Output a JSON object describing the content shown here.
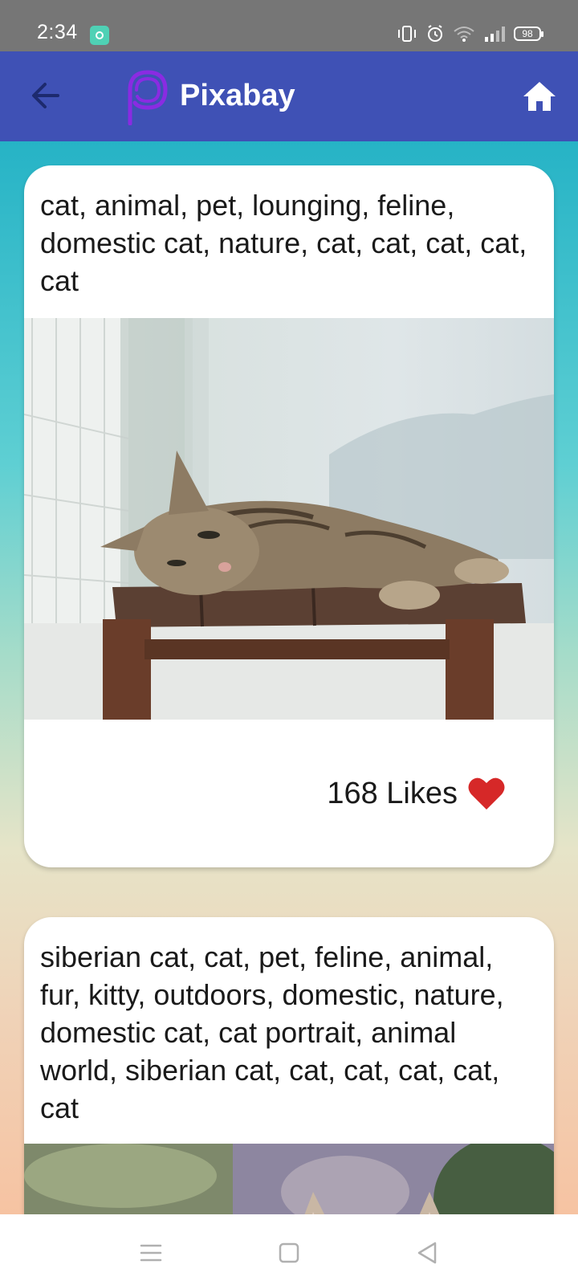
{
  "status_bar": {
    "time": "2:34",
    "battery": "98"
  },
  "app_bar": {
    "title": "Pixabay",
    "logo_icon": "pixabay-p-logo-icon",
    "back_icon": "arrow-left-icon",
    "home_icon": "home-icon"
  },
  "feed": {
    "cards": [
      {
        "tags": "cat, animal, pet, lounging, feline, domestic cat, nature, cat, cat, cat, cat, cat",
        "image": "tabby cat lying on a wooden stool",
        "likes": "168 Likes",
        "like_icon": "heart-icon"
      },
      {
        "tags": "siberian cat, cat, pet, feline, animal, fur, kitty, outdoors, domestic, nature, domestic cat, cat portrait, animal world, siberian cat, cat, cat, cat, cat, cat",
        "image": "cat ears among foliage"
      }
    ]
  },
  "nav_bar": {
    "menu_icon": "recent-apps-icon",
    "home_icon": "home-square-icon",
    "back_icon": "back-triangle-icon"
  },
  "colors": {
    "app_bar": "#3f51b5",
    "logo_purple": "#8a2be2",
    "heart": "#d62828"
  }
}
